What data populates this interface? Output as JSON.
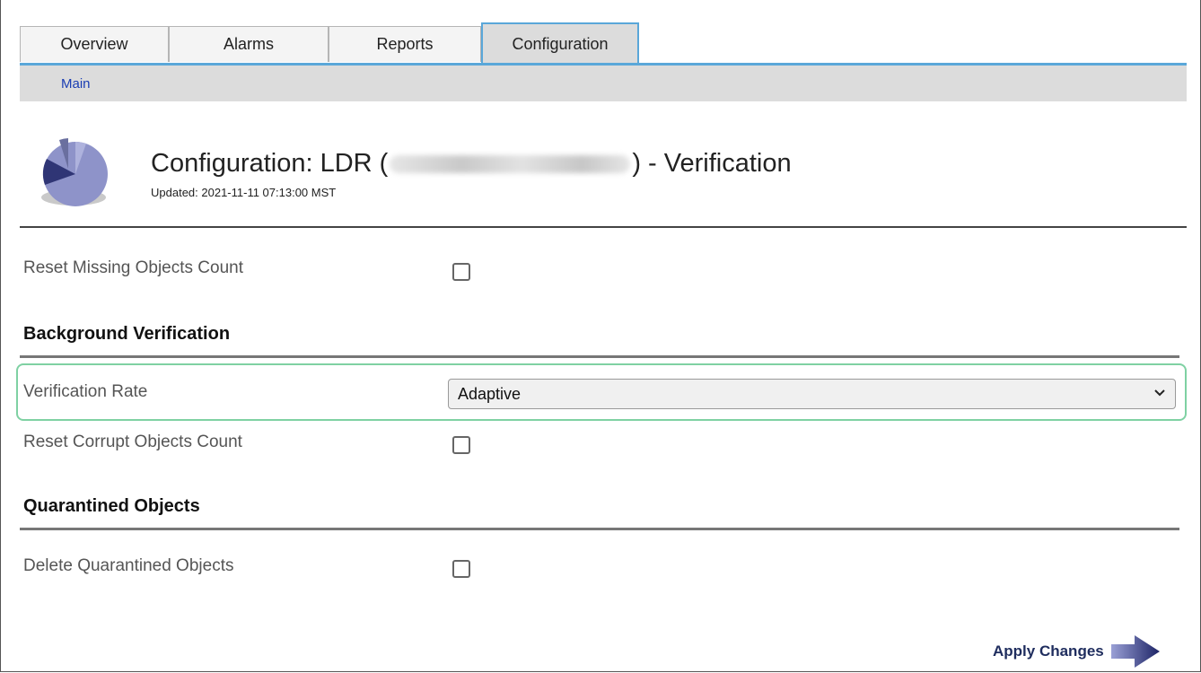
{
  "tabs": [
    {
      "label": "Overview"
    },
    {
      "label": "Alarms"
    },
    {
      "label": "Reports"
    },
    {
      "label": "Configuration"
    }
  ],
  "subnav": {
    "main_label": "Main"
  },
  "header": {
    "title_prefix": "Configuration: LDR (",
    "title_suffix": ") - Verification",
    "updated": "Updated: 2021-11-11 07:13:00 MST"
  },
  "form": {
    "reset_missing_label": "Reset Missing Objects Count",
    "bg_section_title": "Background Verification",
    "verification_rate_label": "Verification Rate",
    "verification_rate_value": "Adaptive",
    "reset_corrupt_label": "Reset Corrupt Objects Count",
    "quarantine_section_title": "Quarantined Objects",
    "delete_quarantined_label": "Delete Quarantined Objects"
  },
  "actions": {
    "apply_label": "Apply Changes"
  },
  "colors": {
    "tab_accent": "#5aa7d9",
    "highlight": "#7fd1a3",
    "link": "#1a3db3"
  },
  "icons": {
    "header": "pie-chart-icon",
    "apply": "arrow-right-icon",
    "select": "chevron-down-icon"
  }
}
